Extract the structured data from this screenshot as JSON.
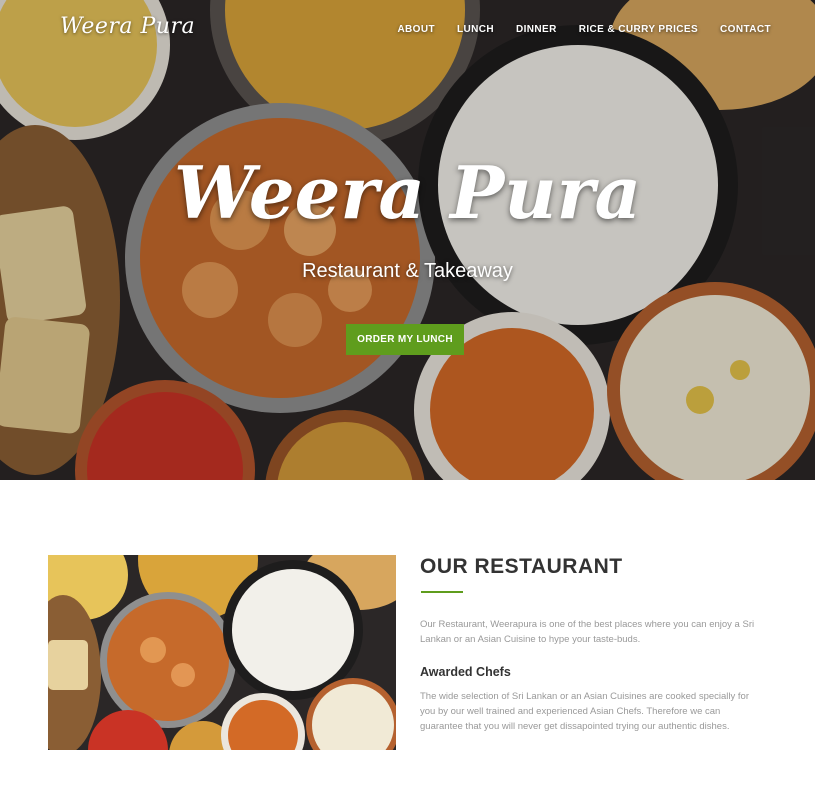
{
  "header": {
    "brand": "Weera Pura",
    "nav": [
      {
        "label": "ABOUT"
      },
      {
        "label": "LUNCH"
      },
      {
        "label": "DINNER"
      },
      {
        "label": "RICE & CURRY PRICES"
      },
      {
        "label": "CONTACT"
      }
    ]
  },
  "hero": {
    "title": "Weera Pura",
    "subtitle": "Restaurant & Takeaway",
    "cta_label": "ORDER MY LUNCH"
  },
  "about": {
    "title": "OUR RESTAURANT",
    "text": "Our Restaurant, Weerapura is one of the best places where you can enjoy a Sri Lankan or an Asian Cuisine to hype your taste-buds.",
    "chefs_title": "Awarded Chefs",
    "chefs_text": "The wide selection of Sri Lankan or an Asian Cuisines are cooked specially for you by our well trained and experienced Asian Chefs. Therefore we can guarantee that you will never get dissapointed trying our authentic dishes."
  },
  "colors": {
    "accent": "#5f9d1d",
    "hero_background": "#2a2626"
  }
}
